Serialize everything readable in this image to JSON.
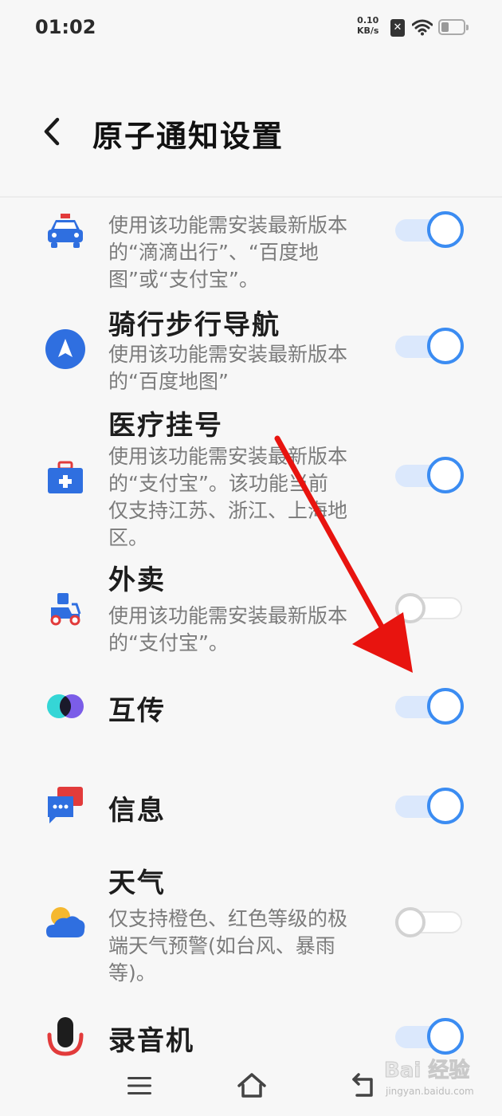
{
  "status_bar": {
    "time": "01:02",
    "net_speed": "0.10",
    "net_unit": "KB/s",
    "icons": [
      "sim-off-icon",
      "wifi-icon",
      "battery-icon"
    ]
  },
  "header": {
    "back_icon": "chevron-left-icon",
    "title": "原子通知设置"
  },
  "items": [
    {
      "id": "taxi",
      "icon": "taxi-icon",
      "title": "",
      "desc": "使用该功能需安装最新版本的“滴滴出行”、“百度地图”或“支付宝”。",
      "enabled": true
    },
    {
      "id": "cycling-walking-nav",
      "icon": "navigation-icon",
      "title": "骑行步行导航",
      "desc": "使用该功能需安装最新版本的“百度地图”",
      "enabled": true
    },
    {
      "id": "medical-registration",
      "icon": "medical-kit-icon",
      "title": "医疗挂号",
      "desc": "使用该功能需安装最新版本的“支付宝”。该功能当前仅支持江苏、浙江、上海地区。",
      "enabled": true
    },
    {
      "id": "takeout",
      "icon": "delivery-scooter-icon",
      "title": "外卖",
      "desc": "使用该功能需安装最新版本的“支付宝”。",
      "enabled": false
    },
    {
      "id": "mutual-transfer",
      "icon": "mutual-transfer-icon",
      "title": "互传",
      "desc": "",
      "enabled": true
    },
    {
      "id": "messages",
      "icon": "message-icon",
      "title": "信息",
      "desc": "",
      "enabled": true
    },
    {
      "id": "weather",
      "icon": "weather-icon",
      "title": "天气",
      "desc": "仅支持橙色、红色等级的极端天气预警(如台风、暴雨等)。",
      "enabled": false
    },
    {
      "id": "recorder",
      "icon": "microphone-icon",
      "title": "录音机",
      "desc": "",
      "enabled": true
    }
  ],
  "nav_bar": {
    "icons": [
      "menu-icon",
      "home-icon",
      "back-icon"
    ]
  },
  "watermark": {
    "brand": "Bai 经验",
    "url": "jingyan.baidu.com"
  },
  "colors": {
    "toggle_on": "#3b8cf2",
    "toggle_on_track": "#dbe8fc",
    "toggle_off": "#d2d2d2",
    "arrow": "#e8140f"
  }
}
